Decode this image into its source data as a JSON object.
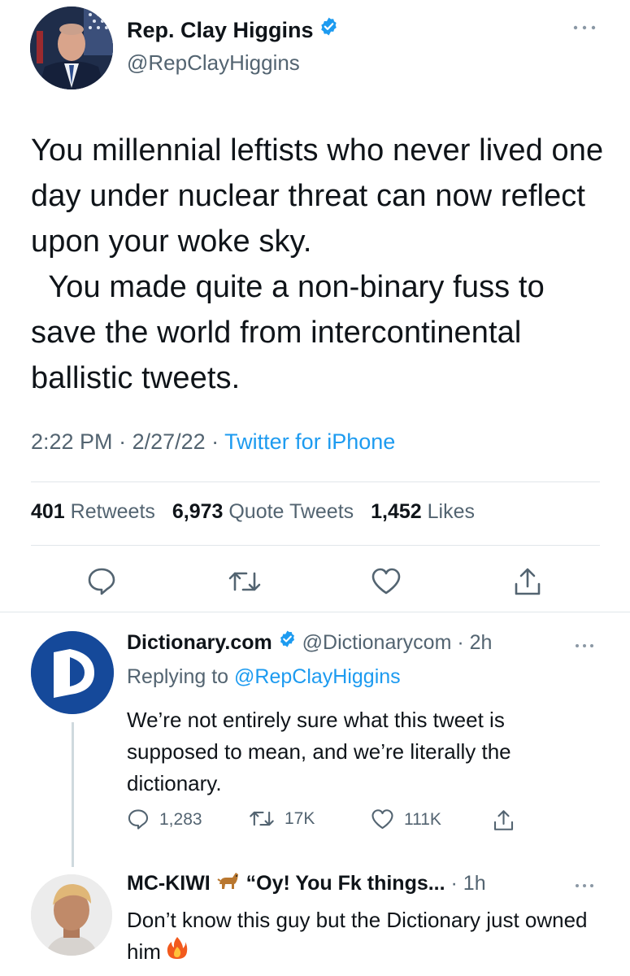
{
  "main_tweet": {
    "author_name": "Rep. Clay Higgins",
    "author_handle": "@RepClayHiggins",
    "text": "You millennial leftists who never lived one day under nuclear threat can now reflect upon your woke sky.\n  You made quite a non-binary fuss to save the world from intercontinental ballistic tweets.",
    "time": "2:22 PM",
    "date": "2/27/22",
    "source": "Twitter for iPhone",
    "stats": {
      "retweets_count": "401",
      "retweets_label": "Retweets",
      "quotes_count": "6,973",
      "quotes_label": "Quote Tweets",
      "likes_count": "1,452",
      "likes_label": "Likes"
    }
  },
  "replies": [
    {
      "author_name": "Dictionary.com",
      "author_handle": "@Dictionarycom",
      "age": "2h",
      "replying_label": "Replying to",
      "replying_to": "@RepClayHiggins",
      "text": "We’re not entirely sure what this tweet is supposed to mean, and we’re literally the dictionary.",
      "counts": {
        "replies": "1,283",
        "retweets": "17K",
        "likes": "111K"
      }
    },
    {
      "author_name": "MC-KIWI",
      "author_name_rest": "“Oy! You Fk things...",
      "age": "1h",
      "text": "Don’t know this guy but the Dictionary just owned him"
    }
  ],
  "icons": [
    "more-icon",
    "verified-badge-icon",
    "reply-icon",
    "retweet-icon",
    "like-icon",
    "share-icon",
    "dog-emoji-icon",
    "fire-emoji-icon"
  ],
  "colors": {
    "link": "#1d9bf0",
    "muted": "#536471",
    "text": "#0f1419",
    "divider": "#e1e6ea",
    "dictionary_blue": "#15499a"
  }
}
